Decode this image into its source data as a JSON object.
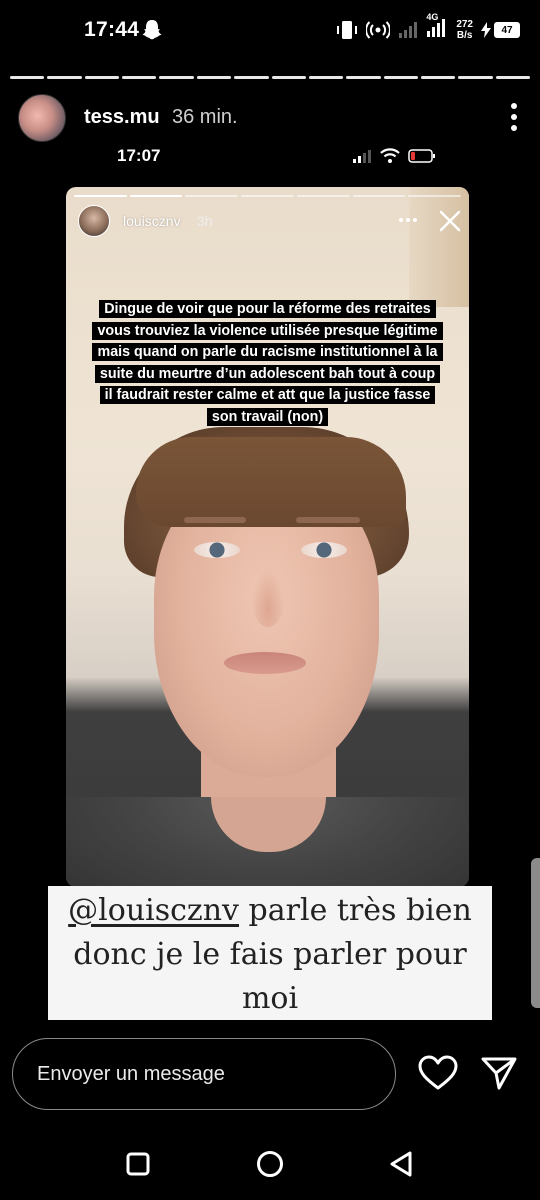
{
  "status_bar": {
    "time": "17:44",
    "network_label": "4G",
    "speed_value": "272",
    "speed_unit": "B/s",
    "battery": "47"
  },
  "story": {
    "progress_segments": 14,
    "username": "tess.mu",
    "time_ago": "36 min."
  },
  "inner_screenshot": {
    "time": "17:07",
    "username": "louisczn v",
    "username_display": "louiscznv",
    "time_ago": "3h",
    "caption": "Dingue de voir que pour la réforme des retraites vous trouviez la violence utilisée presque légitime mais quand on parle du racisme institutionnel à la suite du meurtre d’un adolescent bah tout à coup il faudrait rester calme et att que la justice fasse son travail (non)"
  },
  "overlay": {
    "mention": "@louiscznv",
    "text_after_mention": " parle très bien donc je le fais parler pour moi"
  },
  "message_bar": {
    "placeholder": "Envoyer un message"
  },
  "icons": {
    "ghost": "snapchat-ghost-icon",
    "more": "more-vertical-icon",
    "heart": "heart-icon",
    "send": "send-icon",
    "close": "close-icon"
  },
  "colors": {
    "background": "#000000",
    "text": "#ffffff",
    "overlay_bg": "#f5f5f5"
  }
}
